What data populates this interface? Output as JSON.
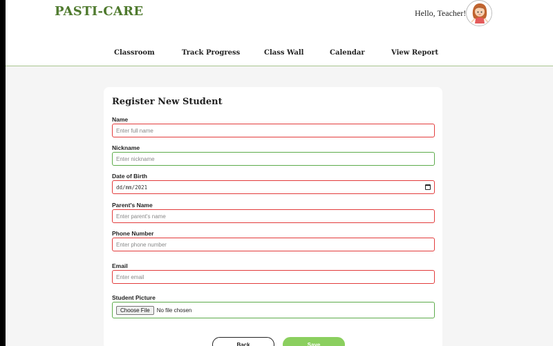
{
  "header": {
    "logo": "PASTI-CARE",
    "greeting": "Hello, Teacher!"
  },
  "nav": [
    {
      "label": "Classroom"
    },
    {
      "label": "Track Progress"
    },
    {
      "label": "Class Wall"
    },
    {
      "label": "Calendar"
    },
    {
      "label": "View Report"
    }
  ],
  "form": {
    "title": "Register New Student",
    "fields": {
      "name": {
        "label": "Name",
        "placeholder": "Enter full name"
      },
      "nickname": {
        "label": "Nickname",
        "placeholder": "Enter nickname"
      },
      "dob": {
        "label": "Date of Birth",
        "value": "dd/mm/2021"
      },
      "parent": {
        "label": "Parent's Name",
        "placeholder": "Enter parent's name"
      },
      "phone": {
        "label": "Phone Number",
        "placeholder": "Enter phone number"
      },
      "email": {
        "label": "Email",
        "placeholder": "Enter email"
      },
      "picture": {
        "label": "Student Picture",
        "button": "Choose File",
        "status": "No file chosen"
      }
    },
    "buttons": {
      "back": "Back",
      "save": "Save"
    }
  },
  "colors": {
    "brand": "#4f7a2e",
    "error_border": "#e23b3b",
    "valid_border": "#5cab4a",
    "save_button": "#8bcf5f"
  },
  "icons": {
    "avatar": "girl-avatar-icon",
    "date": "calendar-icon"
  }
}
